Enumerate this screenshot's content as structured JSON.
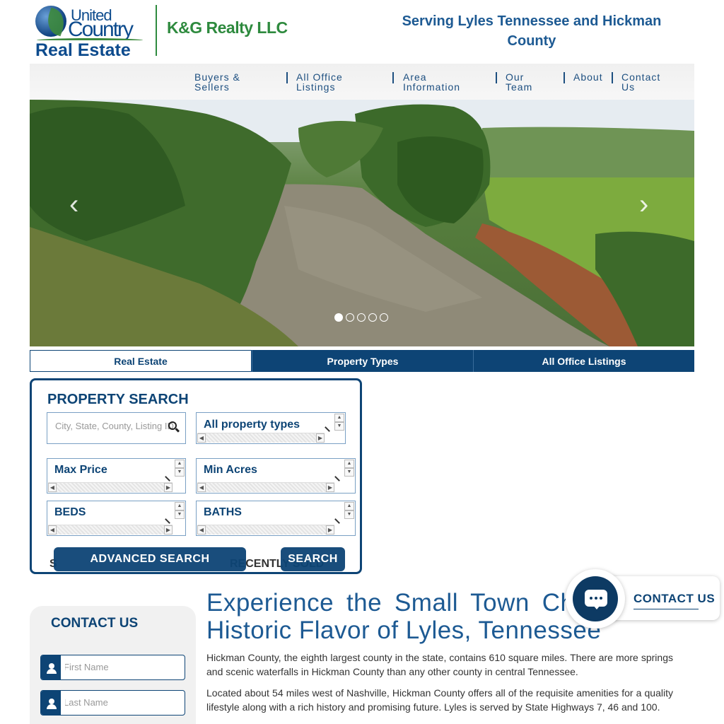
{
  "header": {
    "logo": {
      "line1": "United",
      "line2": "Country",
      "line3": "Real Estate"
    },
    "company": "K&G Realty LLC",
    "tagline": "Serving Lyles Tennessee and Hickman County"
  },
  "nav": {
    "items": [
      {
        "label": "Buyers & Sellers"
      },
      {
        "label": "All Office Listings"
      },
      {
        "label": "Area Information"
      },
      {
        "label": "Our Team"
      },
      {
        "label": "About"
      },
      {
        "label": "Contact Us"
      }
    ]
  },
  "carousel": {
    "prev_icon": "chevron-left-icon",
    "next_icon": "chevron-right-icon",
    "slide_count": 5,
    "active_slide": 1
  },
  "tabs": [
    {
      "label": "Real Estate",
      "active": true
    },
    {
      "label": "Property Types",
      "active": false
    },
    {
      "label": "All Office Listings",
      "active": false
    }
  ],
  "search": {
    "title": "PROPERTY SEARCH",
    "location_placeholder": "City, State, County, Listing ID",
    "property_types": "All property types",
    "max_price": "Max Price",
    "min_acres": "Min Acres",
    "beds": "BEDS",
    "baths": "BATHS",
    "advanced_label": "ADVANCED SEARCH",
    "search_label": "SEARCH",
    "hidden_left": "S",
    "hidden_mid": "RECENTLY SOLD"
  },
  "contact_form": {
    "title": "CONTACT US",
    "first_name_placeholder": "First Name",
    "last_name_placeholder": "Last Name"
  },
  "main": {
    "headline": "Experience the Small Town Charm and Historic Flavor of Lyles, Tennessee",
    "paragraphs": [
      "Hickman County, the eighth largest county in the state, contains 610 square miles. There are more springs and scenic waterfalls in Hickman County than any other county in central Tennessee.",
      "Located about 54 miles west of Nashville, Hickman County offers all of the requisite amenities for a quality lifestyle along with a rich history and promising future. Lyles is served by State Highways 7, 46 and 100."
    ]
  },
  "chat_widget": {
    "label": "CONTACT US",
    "icon": "chat-bubble-icon"
  },
  "colors": {
    "brand_blue": "#0d4475",
    "brand_green": "#2e8a3e",
    "link_blue": "#1d5a93"
  }
}
